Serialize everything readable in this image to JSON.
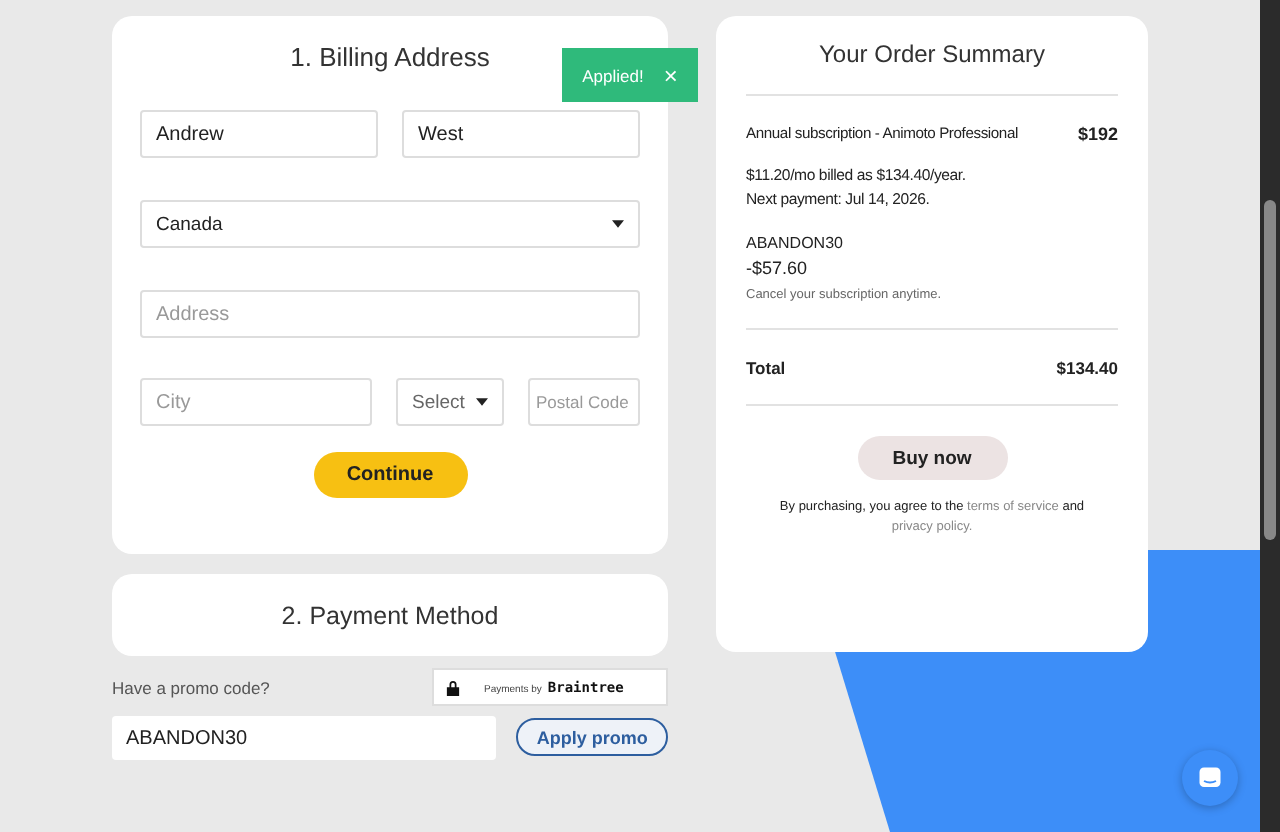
{
  "billing": {
    "title": "1. Billing Address",
    "first_name": {
      "value": "Andrew"
    },
    "last_name": {
      "value": "West"
    },
    "country": {
      "value": "Canada"
    },
    "address": {
      "placeholder": "Address"
    },
    "city": {
      "placeholder": "City"
    },
    "region": {
      "value": "Select"
    },
    "postal": {
      "placeholder": "Postal Code"
    },
    "continue_button": "Continue"
  },
  "toast": {
    "text": "Applied!",
    "close": "×"
  },
  "payment": {
    "title": "2. Payment Method"
  },
  "promo": {
    "label": "Have a promo code?",
    "value": "ABANDON30",
    "button": "Apply promo"
  },
  "badge": {
    "prefix": "Payments by",
    "brand": "Braintree"
  },
  "summary": {
    "title": "Your Order Summary",
    "item": {
      "name": "Annual subscription - Animoto Professional",
      "price": "$192"
    },
    "billing_lines": [
      "$11.20/mo billed as $134.40/year.",
      "Next payment: Jul 14, 2026."
    ],
    "promo_code": "ABANDON30",
    "discount": "-$57.60",
    "note": "Cancel your subscription anytime.",
    "total_label": "Total",
    "total": "$134.40",
    "buy_button": "Buy now",
    "legal": {
      "before": "By purchasing, you agree to the",
      "link_1": "terms of service",
      "middle": "and",
      "link_2": "privacy policy."
    }
  }
}
